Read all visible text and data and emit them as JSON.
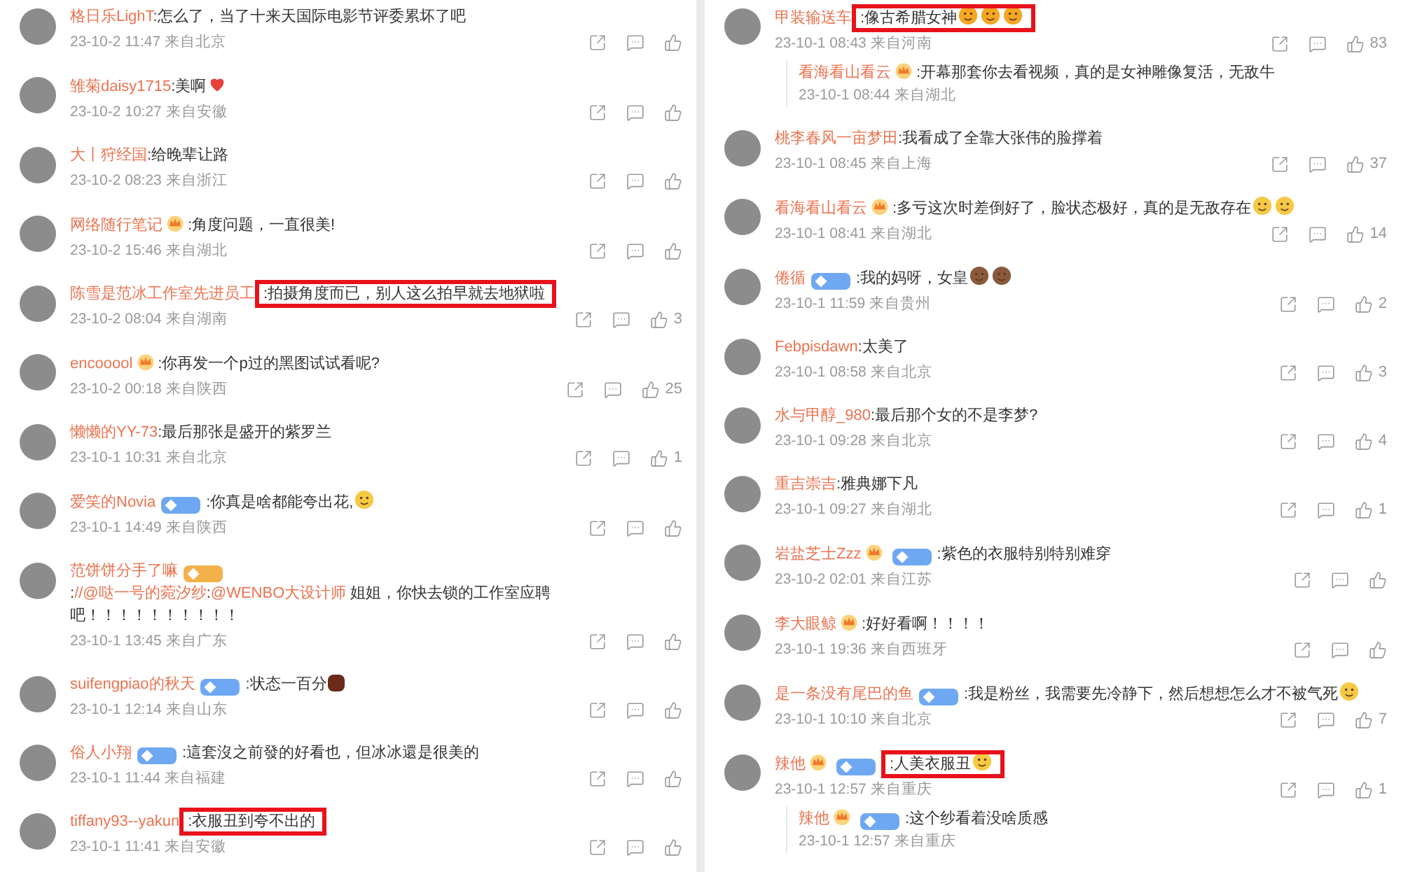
{
  "columns": [
    {
      "comments": [
        {
          "name": "格日乐LighT",
          "content": [
            {
              "kind": "text",
              "text": ":怎么了，当了十来天国际电影节评委累坏了吧"
            }
          ],
          "meta": "23-10-2 11:47 来自北京",
          "highlighted": false
        },
        {
          "name": "雏菊daisy1715",
          "content": [
            {
              "kind": "text",
              "text": ":美啊"
            },
            {
              "kind": "heart"
            }
          ],
          "meta": "23-10-2 10:27 来自安徽",
          "highlighted": false
        },
        {
          "name": "大丨狩经国",
          "content": [
            {
              "kind": "text",
              "text": ":给晚辈让路"
            }
          ],
          "meta": "23-10-2 08:23 来自浙江",
          "highlighted": false
        },
        {
          "name": "网络随行笔记",
          "badges": [
            {
              "kind": "crown"
            }
          ],
          "content": [
            {
              "kind": "text",
              "text": ":角度问题，一直很美!"
            }
          ],
          "meta": "23-10-2 15:46 来自湖北",
          "highlighted": false
        },
        {
          "name": "陈雪是范冰工作室先进员工",
          "content": [
            {
              "kind": "text",
              "text": ":拍摄角度而已，别人这么拍早就去地狱啦"
            }
          ],
          "meta": "23-10-2 08:04 来自湖南",
          "likes": "3",
          "highlighted": true
        },
        {
          "name": "encooool",
          "badges": [
            {
              "kind": "crown"
            }
          ],
          "content": [
            {
              "kind": "text",
              "text": ":你再发一个p过的黑图试试看呢?"
            }
          ],
          "meta": "23-10-2 00:18 来自陕西",
          "likes": "25",
          "highlighted": false
        },
        {
          "name": "懒懒的YY-73",
          "content": [
            {
              "kind": "text",
              "text": ":最后那张是盛开的紫罗兰"
            }
          ],
          "meta": "23-10-1 10:31 来自北京",
          "likes": "1",
          "highlighted": false
        },
        {
          "name": "爱笑的Novia",
          "badges": [
            {
              "kind": "fan",
              "color": "#6fa8f2"
            }
          ],
          "content": [
            {
              "kind": "text",
              "text": ":你真是啥都能夸出花,"
            },
            {
              "kind": "smile"
            }
          ],
          "meta": "23-10-1 14:49 来自陕西",
          "highlighted": false
        },
        {
          "name": "范饼饼分手了嘛",
          "badges": [
            {
              "kind": "fan",
              "color": "#f3b14b"
            }
          ],
          "content": [
            {
              "kind": "text",
              "text": ":"
            },
            {
              "kind": "mention",
              "text": "//@哒一号的菀汐纱"
            },
            {
              "kind": "text",
              "text": ":"
            },
            {
              "kind": "mention",
              "text": "@WENBO大设计师"
            },
            {
              "kind": "text",
              "text": " 姐姐，你快去锁的工作室应聘"
            },
            {
              "kind": "text",
              "text": "吧！！！！！！！！！！"
            }
          ],
          "meta": "23-10-1 13:45 来自广东",
          "highlighted": false
        },
        {
          "name": "suifengpiao的秋天",
          "badges": [
            {
              "kind": "fan",
              "color": "#6fa8f2"
            }
          ],
          "content": [
            {
              "kind": "text",
              "text": ":状态一百分"
            },
            {
              "kind": "chocolate"
            }
          ],
          "meta": "23-10-1 12:14 来自山东",
          "highlighted": false
        },
        {
          "name": "俗人小翔",
          "badges": [
            {
              "kind": "fan",
              "color": "#6fa8f2"
            }
          ],
          "content": [
            {
              "kind": "text",
              "text": ":這套沒之前發的好看也，但冰冰還是很美的"
            }
          ],
          "meta": "23-10-1 11:44 来自福建",
          "highlighted": false
        },
        {
          "name": "tiffany93--yakun",
          "content": [
            {
              "kind": "text",
              "text": ":衣服丑到夸不出的"
            }
          ],
          "meta": "23-10-1 11:41 来自安徽",
          "highlighted": true
        }
      ]
    },
    {
      "comments": [
        {
          "name": "甲装输送车",
          "content": [
            {
              "kind": "text",
              "text": ":像古希腊女神"
            },
            {
              "kind": "heart-eyes"
            },
            {
              "kind": "heart-eyes"
            },
            {
              "kind": "heart-eyes"
            }
          ],
          "meta": "23-10-1 08:43 来自河南",
          "likes": "83",
          "highlighted": true,
          "replies": [
            {
              "name": "看海看山看云",
              "badges": [
                {
                  "kind": "crown"
                }
              ],
              "content": [
                {
                  "kind": "text",
                  "text": ":开幕那套你去看视频，真的是女神雕像复活，无敌牛"
                }
              ],
              "meta": "23-10-1 08:44 来自湖北"
            }
          ]
        },
        {
          "name": "桃李春风一亩梦田",
          "content": [
            {
              "kind": "text",
              "text": ":我看成了全靠大张伟的脸撑着"
            }
          ],
          "meta": "23-10-1 08:45 来自上海",
          "likes": "37",
          "highlighted": false
        },
        {
          "name": "看海看山看云",
          "badges": [
            {
              "kind": "crown"
            }
          ],
          "content": [
            {
              "kind": "text",
              "text": ":多亏这次时差倒好了，脸状态极好，真的是无敌存在"
            },
            {
              "kind": "yum"
            },
            {
              "kind": "yum"
            }
          ],
          "meta": "23-10-1 08:41 来自湖北",
          "likes": "14",
          "highlighted": false
        },
        {
          "name": "倦循",
          "badges": [
            {
              "kind": "fan",
              "color": "#6fa8f2"
            }
          ],
          "content": [
            {
              "kind": "text",
              "text": ":我的妈呀，女皇"
            },
            {
              "kind": "monkey"
            },
            {
              "kind": "monkey"
            }
          ],
          "meta": "23-10-1 11:59 来自贵州",
          "likes": "2",
          "highlighted": false
        },
        {
          "name": "Febpisdawn",
          "content": [
            {
              "kind": "text",
              "text": ":太美了"
            }
          ],
          "meta": "23-10-1 08:58 来自北京",
          "likes": "3",
          "highlighted": false
        },
        {
          "name": "水与甲醇_980",
          "content": [
            {
              "kind": "text",
              "text": ":最后那个女的不是李梦?"
            }
          ],
          "meta": "23-10-1 09:28 来自北京",
          "likes": "4",
          "highlighted": false
        },
        {
          "name": "重吉崇吉",
          "content": [
            {
              "kind": "text",
              "text": ":雅典娜下凡"
            }
          ],
          "meta": "23-10-1 09:27 来自湖北",
          "likes": "1",
          "highlighted": false
        },
        {
          "name": "岩盐芝士Zzz",
          "badges": [
            {
              "kind": "crown"
            },
            {
              "kind": "fan",
              "color": "#6fa8f2"
            }
          ],
          "content": [
            {
              "kind": "text",
              "text": ":紫色的衣服特别特别难穿"
            }
          ],
          "meta": "23-10-2 02:01 来自江苏",
          "highlighted": false
        },
        {
          "name": "李大眼鲸",
          "badges": [
            {
              "kind": "crown"
            }
          ],
          "content": [
            {
              "kind": "text",
              "text": ":好好看啊！！！！"
            }
          ],
          "meta": "23-10-1 19:36 来自西班牙",
          "highlighted": false
        },
        {
          "name": "是一条没有尾巴的鱼",
          "badges": [
            {
              "kind": "fan",
              "color": "#6fa8f2"
            }
          ],
          "content": [
            {
              "kind": "text",
              "text": ":我是粉丝，我需要先冷静下，然后想想怎么才不被气死"
            },
            {
              "kind": "smile"
            }
          ],
          "meta": "23-10-1 10:10 来自北京",
          "likes": "7",
          "highlighted": false
        },
        {
          "name": "辣他",
          "badges": [
            {
              "kind": "crown"
            },
            {
              "kind": "fan",
              "color": "#6fa8f2"
            }
          ],
          "content": [
            {
              "kind": "text",
              "text": ":人美衣服丑"
            },
            {
              "kind": "cry"
            }
          ],
          "meta": "23-10-1 12:57 来自重庆",
          "likes": "1",
          "highlighted": true,
          "replies": [
            {
              "name": "辣他",
              "badges": [
                {
                  "kind": "crown"
                },
                {
                  "kind": "fan",
                  "color": "#6fa8f2"
                }
              ],
              "content": [
                {
                  "kind": "text",
                  "text": ":这个纱看着没啥质感"
                }
              ],
              "meta": "23-10-1 12:57 来自重庆"
            }
          ]
        }
      ]
    }
  ]
}
